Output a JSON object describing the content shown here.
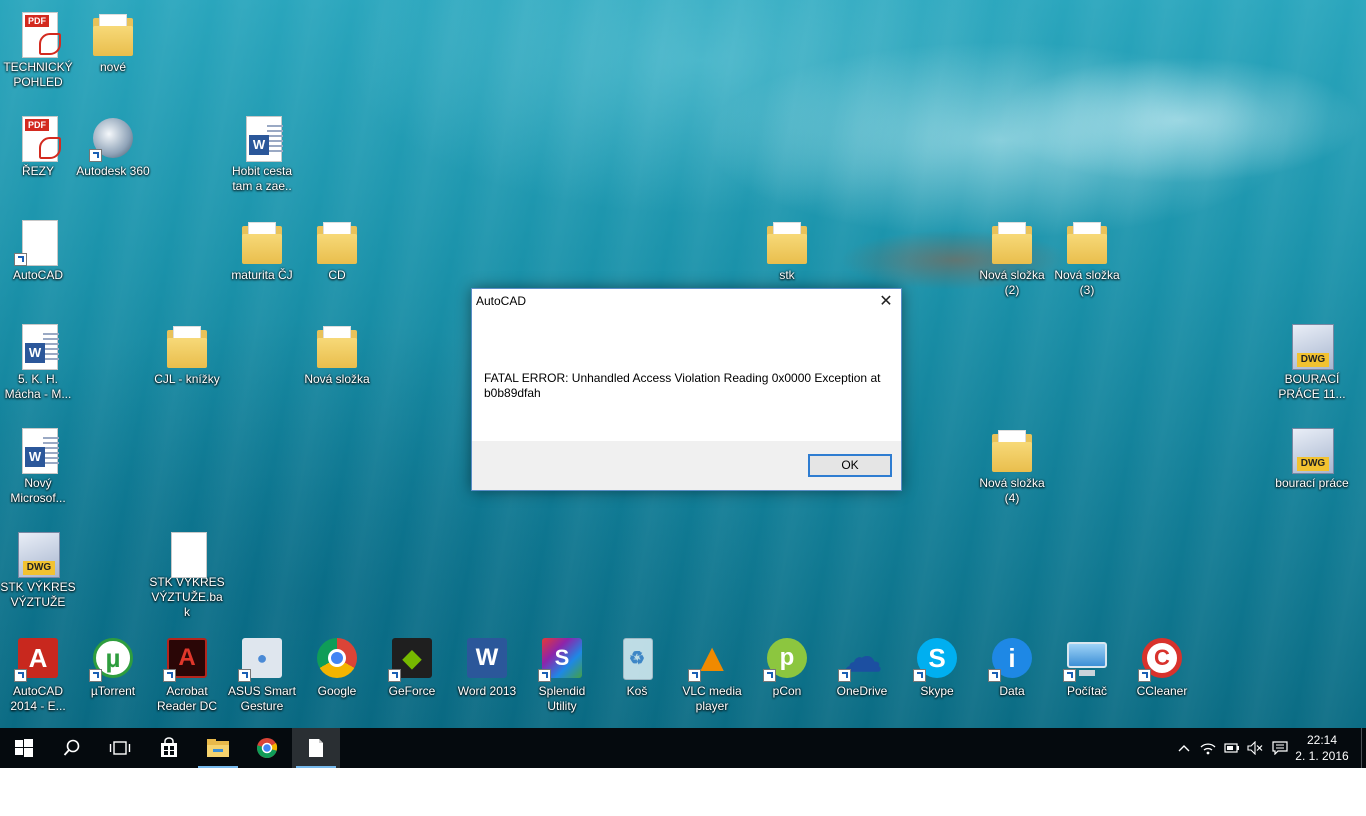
{
  "desktop_icons": [
    {
      "id": "technicky-pohled",
      "label": "TECHNICKÝ POHLED",
      "type": "pdf"
    },
    {
      "id": "nove",
      "label": "nové",
      "type": "folder"
    },
    {
      "id": "rezy",
      "label": "ŘEZY",
      "type": "pdf"
    },
    {
      "id": "autodesk-360",
      "label": "Autodesk 360",
      "type": "app"
    },
    {
      "id": "hobit",
      "label": "Hobit cesta tam a zae..",
      "type": "word"
    },
    {
      "id": "autocad-file",
      "label": "AutoCAD",
      "type": "blank"
    },
    {
      "id": "maturita",
      "label": "maturita ČJ",
      "type": "folder"
    },
    {
      "id": "cd",
      "label": "CD",
      "type": "folder"
    },
    {
      "id": "stk",
      "label": "stk",
      "type": "folder"
    },
    {
      "id": "nova-slozka-2",
      "label": "Nová složka (2)",
      "type": "folder"
    },
    {
      "id": "nova-slozka-3",
      "label": "Nová složka (3)",
      "type": "folder"
    },
    {
      "id": "macha",
      "label": "5. K. H. Mácha - M...",
      "type": "word"
    },
    {
      "id": "cjl-knizky",
      "label": "CJL - knížky",
      "type": "folder"
    },
    {
      "id": "nova-slozka",
      "label": "Nová složka",
      "type": "folder"
    },
    {
      "id": "bouraci-prace-11",
      "label": "BOURACÍ PRÁCE 11...",
      "type": "dwg"
    },
    {
      "id": "novy-microsoft",
      "label": "Nový Microsof...",
      "type": "word"
    },
    {
      "id": "nova-slozka-4",
      "label": "Nová složka (4)",
      "type": "folder"
    },
    {
      "id": "bouraci-prace",
      "label": "bourací práce",
      "type": "dwg"
    },
    {
      "id": "stk-vykres",
      "label": "STK VÝKRES VÝZTUŽE",
      "type": "dwg"
    },
    {
      "id": "stk-vykres-bak",
      "label": "STK VÝKRES VÝZTUŽE.bak",
      "type": "blank"
    }
  ],
  "app_row": [
    {
      "id": "autocad-2014",
      "label": "AutoCAD 2014 - E...",
      "color": "#c8281e",
      "glyph": "A"
    },
    {
      "id": "utorrent",
      "label": "µTorrent",
      "color": "#2e9d3e",
      "glyph": "µ"
    },
    {
      "id": "acrobat",
      "label": "Acrobat Reader DC",
      "color": "#7c1513",
      "glyph": "A"
    },
    {
      "id": "asus-gesture",
      "label": "ASUS Smart Gesture",
      "color": "#dfe6ee",
      "glyph": "●"
    },
    {
      "id": "google",
      "label": "Google",
      "color": "#dd4b39",
      "glyph": "G"
    },
    {
      "id": "geforce",
      "label": "GeForce",
      "color": "#1f1f1f",
      "glyph": "◆"
    },
    {
      "id": "word-2013",
      "label": "Word 2013",
      "color": "#2b579a",
      "glyph": "W"
    },
    {
      "id": "splendid",
      "label": "Splendid Utility",
      "color": "#6a2c91",
      "glyph": "S"
    },
    {
      "id": "kos",
      "label": "Koš",
      "color": "#cfe3ec",
      "glyph": "♻"
    },
    {
      "id": "vlc",
      "label": "VLC media player",
      "color": "#f08a00",
      "glyph": "▲"
    },
    {
      "id": "pcon",
      "label": "pCon",
      "color": "#8cc63f",
      "glyph": "p"
    },
    {
      "id": "onedrive",
      "label": "OneDrive",
      "color": "#1c4fa1",
      "glyph": "☁"
    },
    {
      "id": "skype",
      "label": "Skype",
      "color": "#00aff0",
      "glyph": "S"
    },
    {
      "id": "data",
      "label": "Data",
      "color": "#1e88e5",
      "glyph": "i"
    },
    {
      "id": "pocitac",
      "label": "Počítač",
      "color": "#3d8fd6",
      "glyph": "▭"
    },
    {
      "id": "ccleaner",
      "label": "CCleaner",
      "color": "#d8322c",
      "glyph": "C"
    }
  ],
  "dialog": {
    "title": "AutoCAD",
    "close_glyph": "✕",
    "message": "FATAL ERROR: Unhandled Access Violation Reading 0x0000 Exception at b0b89dfah",
    "ok_label": "OK"
  },
  "taskbar": {
    "time": "22:14",
    "date": "2. 1. 2016"
  },
  "colors": {
    "accent": "#2f7dd1",
    "taskbar": "#050a0e"
  }
}
